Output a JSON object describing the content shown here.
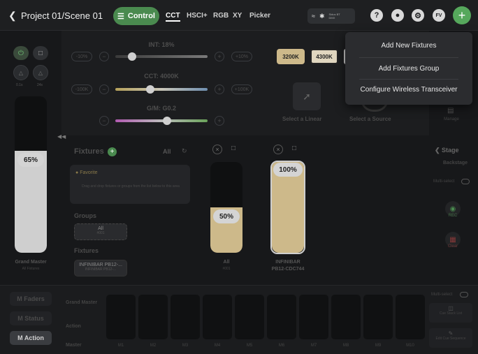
{
  "header": {
    "title": "Project 01/Scene 01",
    "control_label": "Control",
    "tabs": [
      "CCT",
      "HSCI+",
      "RGB",
      "XY",
      "Picker"
    ],
    "active_tab": "CCT",
    "status_line1": "Sidus BT",
    "status_line2": "DMX",
    "user_initials": "FV"
  },
  "left": {
    "mini_labels": [
      "0.1s",
      "24s"
    ],
    "grand_master_value": "65%",
    "grand_master_fill": 0.65,
    "grand_master_label": "Grand Master",
    "grand_master_sub": "All Fixtures"
  },
  "controls": {
    "int_label": "INT: 18%",
    "int_value": 0.18,
    "int_minus": "-10%",
    "int_plus": "+10%",
    "cct_label": "CCT: 4000K",
    "cct_value": 0.38,
    "cct_minus": "-100K",
    "cct_plus": "+100K",
    "gm_label": "G/M: G0.2",
    "gm_value": 0.56,
    "presets": [
      "3200K",
      "4300K"
    ],
    "select_linear": "Select a Linear",
    "select_source": "Select a Source"
  },
  "fixtures": {
    "title": "Fixtures",
    "all_label": "All",
    "favorite_label": "Favorite",
    "drop_hint": "Drag and drop fixtures or groups from the list below to this area",
    "groups_label": "Groups",
    "group_chip_name": "All",
    "group_chip_id": "#001",
    "fixtures_label": "Fixtures",
    "fixture_chip_name": "INFINIBAR PB12-...",
    "fixture_chip_sub": "INFINIBAR PB12-...",
    "fader_all_value": "50%",
    "fader_all_fill": 0.5,
    "fader_all_label": "All",
    "fader_all_sub": "#001",
    "fader_fx_value": "100%",
    "fader_fx_fill": 1.0,
    "fader_fx_label": "INFINIBAR",
    "fader_fx_sub": "PB12-CDC744"
  },
  "right": {
    "manage_label": "Manage",
    "stage_label": "Stage",
    "backstage_label": "Backstage",
    "multiselect_label": "Multi-select",
    "rec_label": "REC",
    "clear_label": "Clear"
  },
  "bottom": {
    "buttons": [
      "M Faders",
      "M Status",
      "M Action"
    ],
    "active_button": "M Action",
    "row_labels": [
      "Grand Master",
      "Action",
      "Master"
    ],
    "slots": [
      "M1",
      "M2",
      "M3",
      "M4",
      "M5",
      "M6",
      "M7",
      "M8",
      "M9",
      "M10"
    ],
    "multiselect_label": "Multi-select",
    "cue_stack_label": "Cue Stack List",
    "edit_cue_label": "Edit Cue Sequence"
  },
  "menu": {
    "items": [
      "Add New Fixtures",
      "Add Fixtures Group",
      "Configure Wireless Transceiver"
    ]
  },
  "colors": {
    "accent_green": "#56a85c",
    "warm_fill": "#cdb98a",
    "preset_3200": "#cdb98a",
    "preset_4300": "#e0d6bf"
  }
}
